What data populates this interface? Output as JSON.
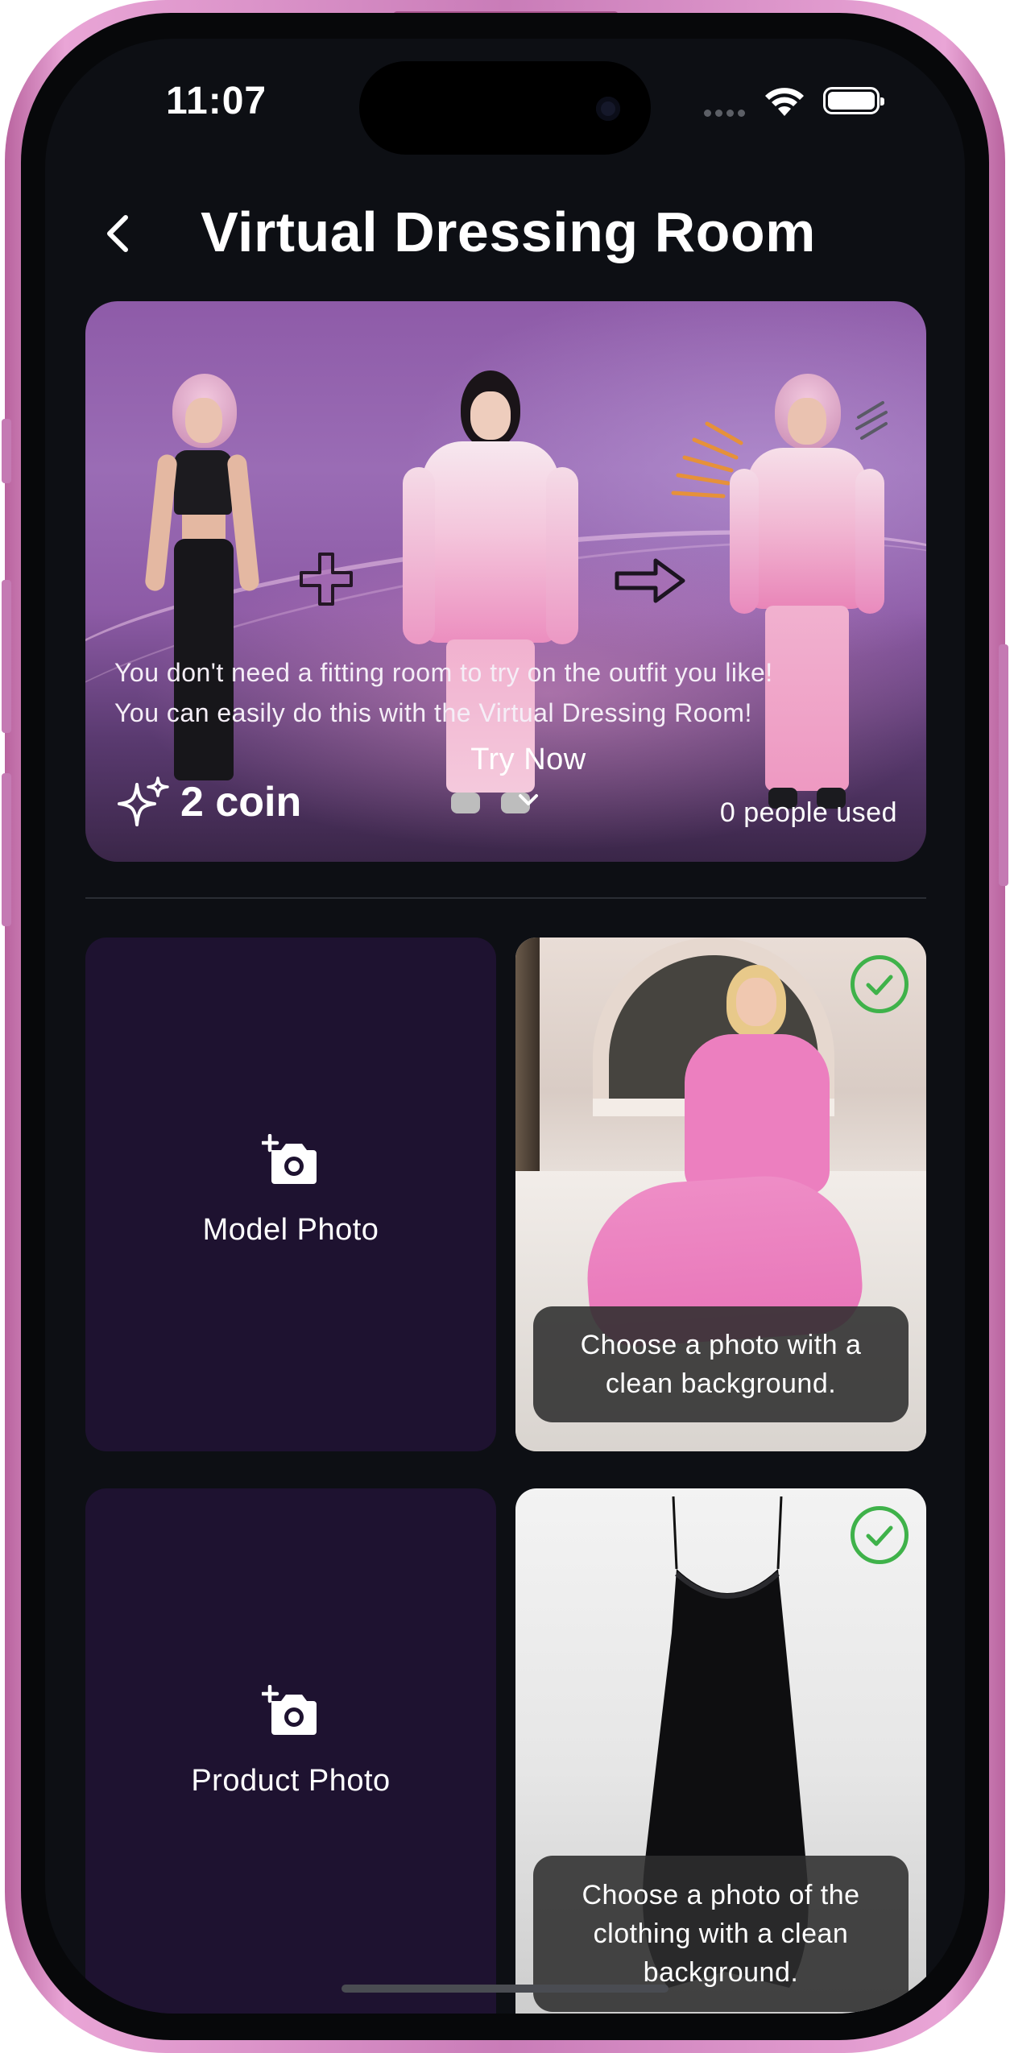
{
  "status_bar": {
    "time": "11:07"
  },
  "header": {
    "title": "Virtual Dressing Room",
    "back_icon": "chevron-left-icon"
  },
  "hero": {
    "description_line1": "You don't need a fitting room to try on the outfit you like!",
    "description_line2": "You can easily do this with the Virtual Dressing Room!",
    "coin_amount": "2 coin",
    "coin_icon": "sparkles-icon",
    "try_now_label": "Try Now",
    "try_now_icon": "chevron-down-icon",
    "usage_text": "0 people used"
  },
  "upload": {
    "model": {
      "label": "Model Photo",
      "icon": "add-camera-icon",
      "example_tip": "Choose a photo with a clean background."
    },
    "product": {
      "label": "Product Photo",
      "icon": "add-camera-icon",
      "example_tip": "Choose a photo of the clothing with a clean background."
    }
  },
  "colors": {
    "accent_check": "#3fb24a",
    "card_bg": "#1e1230",
    "screen_bg": "#0d0f14"
  }
}
